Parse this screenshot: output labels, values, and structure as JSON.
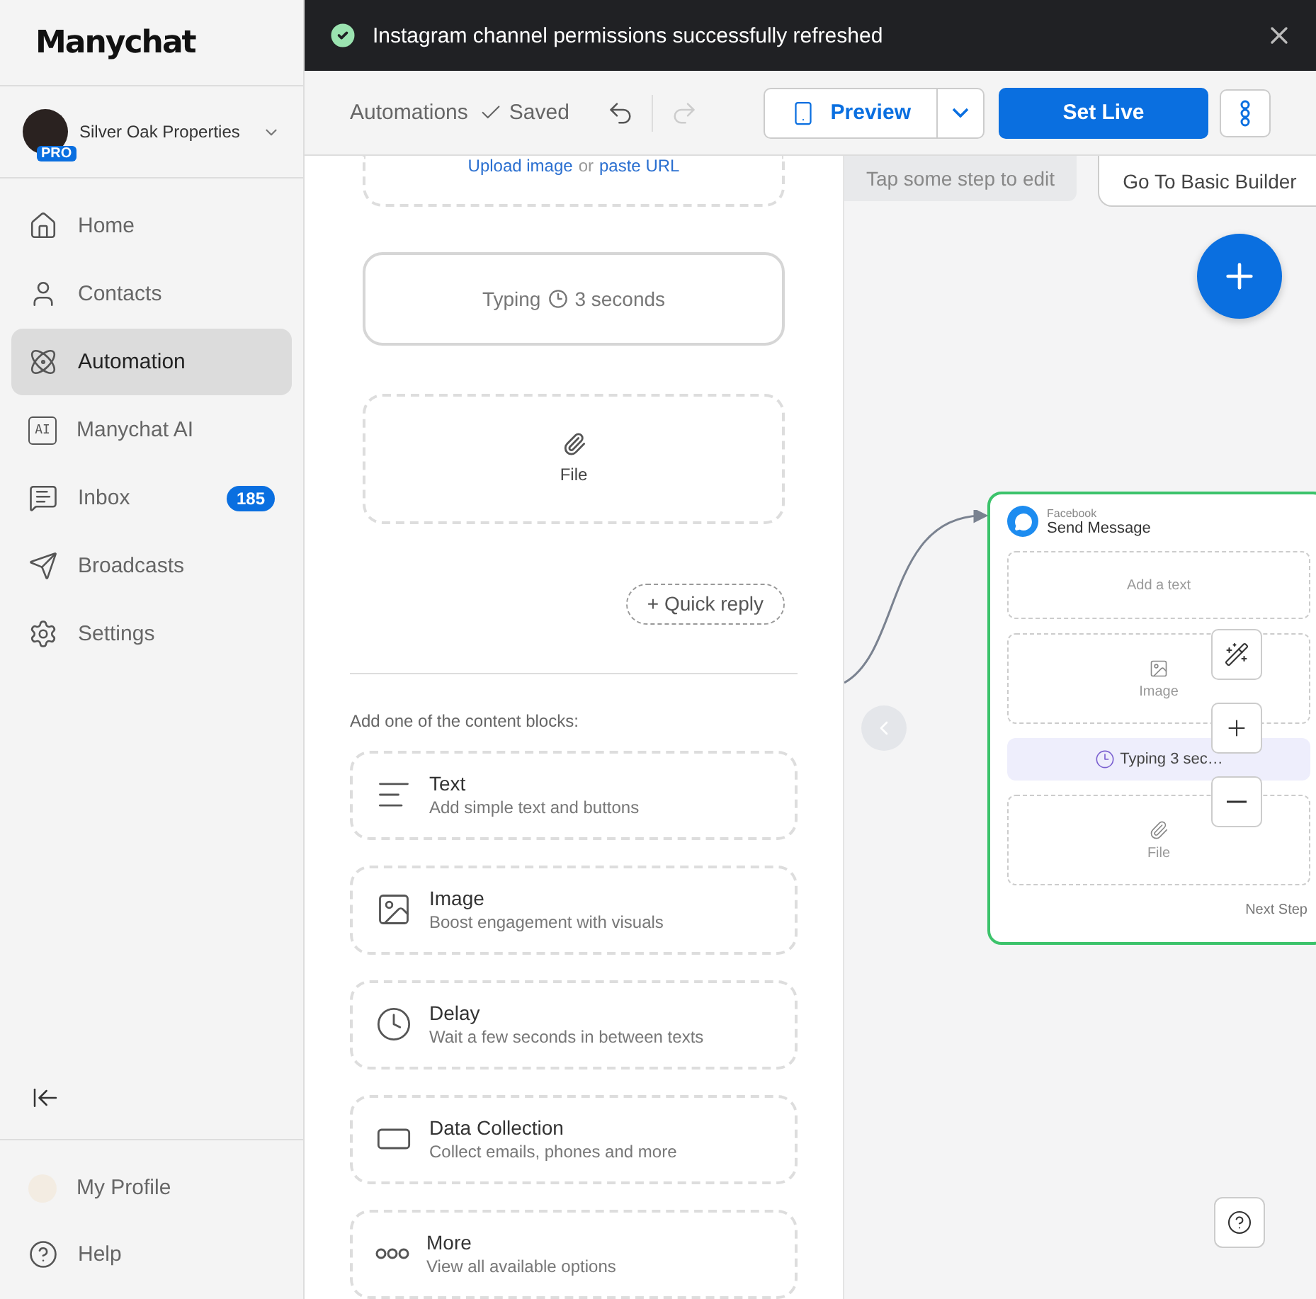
{
  "toast": {
    "kind": "success",
    "text": "Instagram channel permissions successfully refreshed"
  },
  "sidebar": {
    "logo": "Manychat",
    "workspace": {
      "name": "Silver Oak Properties",
      "badge": "PRO"
    },
    "items": [
      {
        "kind": "home",
        "label": "Home",
        "selected": false
      },
      {
        "kind": "contacts",
        "label": "Contacts",
        "selected": false
      },
      {
        "kind": "automation",
        "label": "Automation",
        "selected": true
      },
      {
        "kind": "ai",
        "icon_text": "AI",
        "label": "Manychat AI",
        "selected": false
      },
      {
        "kind": "inbox",
        "label": "Inbox",
        "badge": "185",
        "selected": false
      },
      {
        "kind": "broadcasts",
        "label": "Broadcasts",
        "selected": false
      },
      {
        "kind": "settings",
        "label": "Settings",
        "selected": false
      }
    ],
    "bottom": [
      {
        "kind": "profile",
        "label": "My Profile"
      },
      {
        "kind": "help",
        "label": "Help"
      }
    ]
  },
  "header": {
    "breadcrumb": "Automations",
    "status": "Saved",
    "redo_disabled": true,
    "preview": "Preview",
    "set_live": "Set Live"
  },
  "panel": {
    "upload": {
      "link1": "Upload image",
      "middle": "or",
      "link2": "paste URL"
    },
    "typing": {
      "label": "Typing",
      "duration": "3 seconds"
    },
    "file": "File",
    "quick_reply": "+ Quick reply",
    "blocks_heading": "Add one of the content blocks:",
    "blocks": [
      {
        "kind": "text",
        "title": "Text",
        "subtitle": "Add simple text and buttons"
      },
      {
        "kind": "image",
        "title": "Image",
        "subtitle": "Boost engagement with visuals"
      },
      {
        "kind": "delay",
        "title": "Delay",
        "subtitle": "Wait a few seconds in between texts"
      },
      {
        "kind": "data",
        "title": "Data Collection",
        "subtitle": "Collect emails, phones and more"
      },
      {
        "kind": "more",
        "title": "More",
        "subtitle": "View all available options"
      }
    ]
  },
  "canvas": {
    "hint": "Tap some step to edit",
    "basic_builder": "Go To Basic Builder",
    "node": {
      "channel": "Facebook",
      "title": "Send Message",
      "footer": "Next Step",
      "blocks": [
        {
          "kind": "placeholder",
          "text": "Add a text"
        },
        {
          "kind": "image",
          "text": "Image"
        },
        {
          "kind": "typing",
          "text": "Typing 3 sec…"
        },
        {
          "kind": "file",
          "text": "File"
        }
      ]
    }
  }
}
